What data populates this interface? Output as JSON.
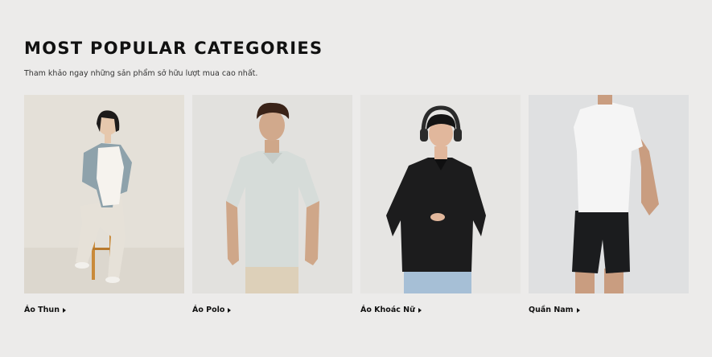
{
  "section": {
    "title": "MOST POPULAR CATEGORIES",
    "subtitle": "Tham khảo ngay những sản phẩm sở hữu lượt mua cao nhất."
  },
  "categories": [
    {
      "label": "Áo Thun",
      "icon": "caret-right-icon"
    },
    {
      "label": "Áo Polo",
      "icon": "caret-right-icon"
    },
    {
      "label": "Áo Khoác Nữ",
      "icon": "caret-right-icon"
    },
    {
      "label": "Quần Nam",
      "icon": "caret-right-icon"
    }
  ],
  "colors": {
    "background": "#ecebea",
    "text": "#111111"
  }
}
